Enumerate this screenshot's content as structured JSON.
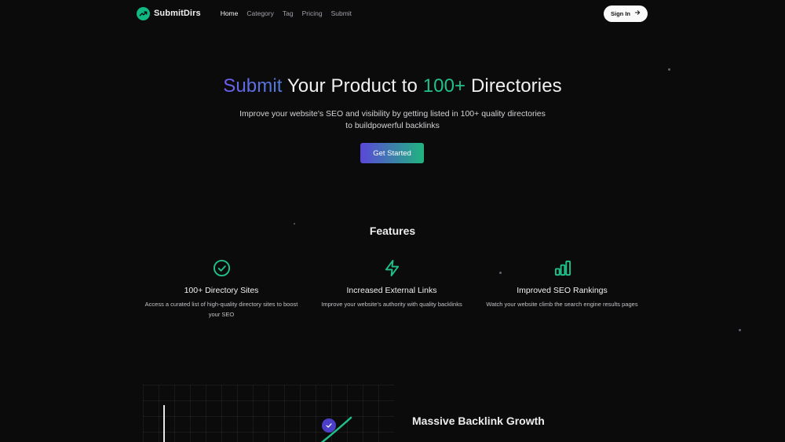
{
  "nav": {
    "brand": "SubmitDirs",
    "links": [
      {
        "label": "Home",
        "active": true
      },
      {
        "label": "Category"
      },
      {
        "label": "Tag"
      },
      {
        "label": "Pricing"
      },
      {
        "label": "Submit"
      }
    ],
    "signin_label": "Sign In"
  },
  "hero": {
    "title_part1": "Submit",
    "title_part2": " Your Product to ",
    "title_part3": "100+",
    "title_part4": " Directories",
    "subtitle": "Improve your website's SEO and visibility by getting listed in 100+ quality directories to buildpowerful backlinks",
    "cta_label": "Get Started"
  },
  "features": {
    "title": "Features",
    "items": [
      {
        "icon": "check-circle-icon",
        "title": "100+ Directory Sites",
        "desc": "Access a curated list of high-quality directory sites to boost your SEO"
      },
      {
        "icon": "lightning-icon",
        "title": "Increased External Links",
        "desc": "Improve your website's authority with quality backlinks"
      },
      {
        "icon": "bar-chart-icon",
        "title": "Improved SEO Rankings",
        "desc": "Watch your website climb the search engine results pages"
      }
    ]
  },
  "backlinks": {
    "title": "Massive Backlink Growth"
  },
  "colors": {
    "background": "#0b0b0c",
    "accent_green": "#21c08b",
    "accent_purple": "#5b47d9"
  }
}
